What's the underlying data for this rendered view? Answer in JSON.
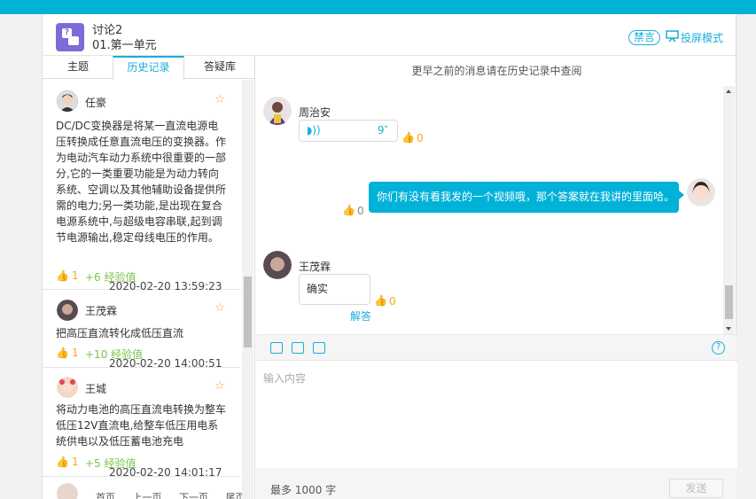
{
  "header": {
    "title": "讨论2",
    "subtitle": "01.第一单元",
    "mute_label": "禁言",
    "projection_label": "投屏模式"
  },
  "tabs": [
    {
      "label": "主题"
    },
    {
      "label": "历史记录",
      "active": true
    },
    {
      "label": "答疑库"
    }
  ],
  "posts": [
    {
      "name": "任豪",
      "content": "DC/DC变换器是将某一直流电源电压转换成任意直流电压的变换器。作为电动汽车动力系统中很重要的一部分,它的一类重要功能是为动力转向系统、空调以及其他辅助设备提供所需的电力;另一类功能,是出现在复合电源系统中,与超级电容串联,起到调节电源输出,稳定母线电压的作用。",
      "likes": "1",
      "exp": "+6 经验值",
      "time": "2020-02-20 13:59:23"
    },
    {
      "name": "王茂霖",
      "content": "把高压直流转化成低压直流",
      "likes": "1",
      "exp": "+10 经验值",
      "time": "2020-02-20 14:00:51"
    },
    {
      "name": "王城",
      "content": "将动力电池的高压直流电转换为整车低压12V直流电,给整车低压用电系统供电以及低压蓄电池充电",
      "likes": "1",
      "exp": "+5 经验值",
      "time": "2020-02-20 14:01:17"
    }
  ],
  "pager": [
    "首页",
    "上一页",
    "下一页",
    "尾页"
  ],
  "chat": {
    "history_tip": "更早之前的消息请在历史记录中查阅",
    "messages": [
      {
        "name": "周治安",
        "type": "voice",
        "duration": "9″",
        "likes": "0"
      },
      {
        "name": "",
        "type": "text",
        "text": "你们有没有看我发的一个视频哦，那个答案就在我讲的里面哈。",
        "likes": "0"
      },
      {
        "name": "王茂霖",
        "type": "text",
        "text": "确实",
        "likes": "0",
        "action": "解答"
      }
    ]
  },
  "composer": {
    "placeholder": "输入内容",
    "limit": "最多 1000 字",
    "send_label": "发送"
  },
  "colors": {
    "accent": "#00b1d8",
    "like": "#f5a623",
    "exp": "#7bc34b"
  }
}
